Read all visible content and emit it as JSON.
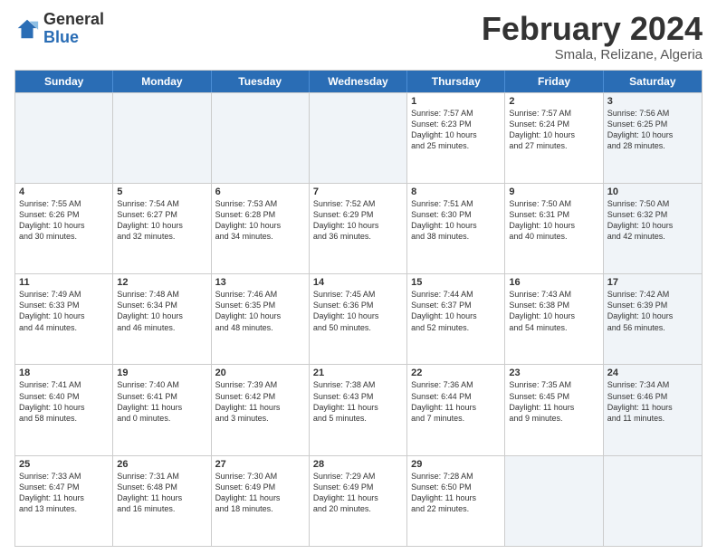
{
  "logo": {
    "general": "General",
    "blue": "Blue"
  },
  "header": {
    "title": "February 2024",
    "subtitle": "Smala, Relizane, Algeria"
  },
  "days": [
    "Sunday",
    "Monday",
    "Tuesday",
    "Wednesday",
    "Thursday",
    "Friday",
    "Saturday"
  ],
  "weeks": [
    [
      {
        "day": "",
        "info": "",
        "shaded": true
      },
      {
        "day": "",
        "info": "",
        "shaded": true
      },
      {
        "day": "",
        "info": "",
        "shaded": true
      },
      {
        "day": "",
        "info": "",
        "shaded": true
      },
      {
        "day": "1",
        "info": "Sunrise: 7:57 AM\nSunset: 6:23 PM\nDaylight: 10 hours\nand 25 minutes.",
        "shaded": false
      },
      {
        "day": "2",
        "info": "Sunrise: 7:57 AM\nSunset: 6:24 PM\nDaylight: 10 hours\nand 27 minutes.",
        "shaded": false
      },
      {
        "day": "3",
        "info": "Sunrise: 7:56 AM\nSunset: 6:25 PM\nDaylight: 10 hours\nand 28 minutes.",
        "shaded": true
      }
    ],
    [
      {
        "day": "4",
        "info": "Sunrise: 7:55 AM\nSunset: 6:26 PM\nDaylight: 10 hours\nand 30 minutes.",
        "shaded": false
      },
      {
        "day": "5",
        "info": "Sunrise: 7:54 AM\nSunset: 6:27 PM\nDaylight: 10 hours\nand 32 minutes.",
        "shaded": false
      },
      {
        "day": "6",
        "info": "Sunrise: 7:53 AM\nSunset: 6:28 PM\nDaylight: 10 hours\nand 34 minutes.",
        "shaded": false
      },
      {
        "day": "7",
        "info": "Sunrise: 7:52 AM\nSunset: 6:29 PM\nDaylight: 10 hours\nand 36 minutes.",
        "shaded": false
      },
      {
        "day": "8",
        "info": "Sunrise: 7:51 AM\nSunset: 6:30 PM\nDaylight: 10 hours\nand 38 minutes.",
        "shaded": false
      },
      {
        "day": "9",
        "info": "Sunrise: 7:50 AM\nSunset: 6:31 PM\nDaylight: 10 hours\nand 40 minutes.",
        "shaded": false
      },
      {
        "day": "10",
        "info": "Sunrise: 7:50 AM\nSunset: 6:32 PM\nDaylight: 10 hours\nand 42 minutes.",
        "shaded": true
      }
    ],
    [
      {
        "day": "11",
        "info": "Sunrise: 7:49 AM\nSunset: 6:33 PM\nDaylight: 10 hours\nand 44 minutes.",
        "shaded": false
      },
      {
        "day": "12",
        "info": "Sunrise: 7:48 AM\nSunset: 6:34 PM\nDaylight: 10 hours\nand 46 minutes.",
        "shaded": false
      },
      {
        "day": "13",
        "info": "Sunrise: 7:46 AM\nSunset: 6:35 PM\nDaylight: 10 hours\nand 48 minutes.",
        "shaded": false
      },
      {
        "day": "14",
        "info": "Sunrise: 7:45 AM\nSunset: 6:36 PM\nDaylight: 10 hours\nand 50 minutes.",
        "shaded": false
      },
      {
        "day": "15",
        "info": "Sunrise: 7:44 AM\nSunset: 6:37 PM\nDaylight: 10 hours\nand 52 minutes.",
        "shaded": false
      },
      {
        "day": "16",
        "info": "Sunrise: 7:43 AM\nSunset: 6:38 PM\nDaylight: 10 hours\nand 54 minutes.",
        "shaded": false
      },
      {
        "day": "17",
        "info": "Sunrise: 7:42 AM\nSunset: 6:39 PM\nDaylight: 10 hours\nand 56 minutes.",
        "shaded": true
      }
    ],
    [
      {
        "day": "18",
        "info": "Sunrise: 7:41 AM\nSunset: 6:40 PM\nDaylight: 10 hours\nand 58 minutes.",
        "shaded": false
      },
      {
        "day": "19",
        "info": "Sunrise: 7:40 AM\nSunset: 6:41 PM\nDaylight: 11 hours\nand 0 minutes.",
        "shaded": false
      },
      {
        "day": "20",
        "info": "Sunrise: 7:39 AM\nSunset: 6:42 PM\nDaylight: 11 hours\nand 3 minutes.",
        "shaded": false
      },
      {
        "day": "21",
        "info": "Sunrise: 7:38 AM\nSunset: 6:43 PM\nDaylight: 11 hours\nand 5 minutes.",
        "shaded": false
      },
      {
        "day": "22",
        "info": "Sunrise: 7:36 AM\nSunset: 6:44 PM\nDaylight: 11 hours\nand 7 minutes.",
        "shaded": false
      },
      {
        "day": "23",
        "info": "Sunrise: 7:35 AM\nSunset: 6:45 PM\nDaylight: 11 hours\nand 9 minutes.",
        "shaded": false
      },
      {
        "day": "24",
        "info": "Sunrise: 7:34 AM\nSunset: 6:46 PM\nDaylight: 11 hours\nand 11 minutes.",
        "shaded": true
      }
    ],
    [
      {
        "day": "25",
        "info": "Sunrise: 7:33 AM\nSunset: 6:47 PM\nDaylight: 11 hours\nand 13 minutes.",
        "shaded": false
      },
      {
        "day": "26",
        "info": "Sunrise: 7:31 AM\nSunset: 6:48 PM\nDaylight: 11 hours\nand 16 minutes.",
        "shaded": false
      },
      {
        "day": "27",
        "info": "Sunrise: 7:30 AM\nSunset: 6:49 PM\nDaylight: 11 hours\nand 18 minutes.",
        "shaded": false
      },
      {
        "day": "28",
        "info": "Sunrise: 7:29 AM\nSunset: 6:49 PM\nDaylight: 11 hours\nand 20 minutes.",
        "shaded": false
      },
      {
        "day": "29",
        "info": "Sunrise: 7:28 AM\nSunset: 6:50 PM\nDaylight: 11 hours\nand 22 minutes.",
        "shaded": false
      },
      {
        "day": "",
        "info": "",
        "shaded": true
      },
      {
        "day": "",
        "info": "",
        "shaded": true
      }
    ]
  ]
}
